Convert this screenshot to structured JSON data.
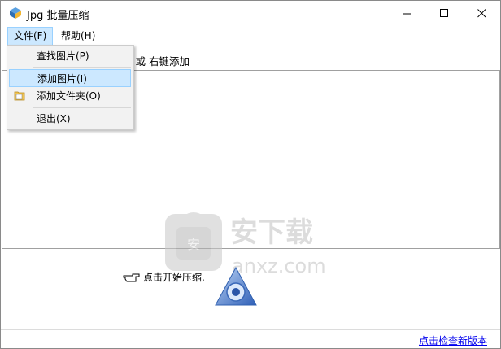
{
  "window": {
    "title": "Jpg 批量压缩"
  },
  "menubar": {
    "file": "文件(F)",
    "help": "帮助(H)"
  },
  "file_menu": {
    "items": [
      {
        "label": "查找图片(P)"
      },
      {
        "label": "添加图片(I)"
      },
      {
        "label": "添加文件夹(O)"
      },
      {
        "label": "退出(X)"
      }
    ]
  },
  "main": {
    "hint_visible": "表 或 右键添加",
    "start_hint": "点击开始压缩.",
    "watermark_title": "安下载",
    "watermark_domain": "anxz.com"
  },
  "footer": {
    "update_link": "点击检查新版本"
  },
  "colors": {
    "highlight": "#cce8ff",
    "highlight_border": "#99d1ff",
    "link": "#0000ee"
  },
  "icons": {
    "app": "app-icon",
    "minimize": "minimize-icon",
    "maximize": "maximize-icon",
    "close": "close-icon",
    "folder": "folder-icon",
    "pointing_hand": "pointing-hand-icon",
    "logo": "triangle-eye-logo"
  }
}
